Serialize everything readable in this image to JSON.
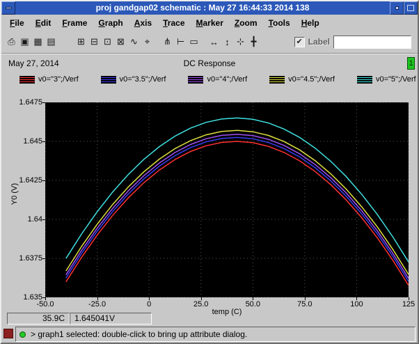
{
  "window": {
    "title": "proj gandgap02 schematic : May 27 16:44:33 2014 138"
  },
  "menu": {
    "items": [
      "File",
      "Edit",
      "Frame",
      "Graph",
      "Axis",
      "Trace",
      "Marker",
      "Zoom",
      "Tools",
      "Help"
    ]
  },
  "toolbar": {
    "icons": [
      {
        "name": "print",
        "glyph": "⎙"
      },
      {
        "name": "snapshot",
        "glyph": "▣"
      },
      {
        "name": "grid-display",
        "glyph": "▦"
      },
      {
        "name": "strip-mode",
        "glyph": "▤"
      },
      {
        "name": "subwindow",
        "glyph": "⊞"
      },
      {
        "name": "overlay",
        "glyph": "⊟"
      },
      {
        "name": "composite",
        "glyph": "⊡"
      },
      {
        "name": "delete-trace",
        "glyph": "⊠"
      },
      {
        "name": "slope-marker",
        "glyph": "∿"
      },
      {
        "name": "point-marker",
        "glyph": "⌖"
      },
      {
        "name": "vert-marker",
        "glyph": "⋔"
      },
      {
        "name": "horiz-marker",
        "glyph": "⊢"
      },
      {
        "name": "zoom-fit",
        "glyph": "▭"
      },
      {
        "name": "zoom-x",
        "glyph": "↔"
      },
      {
        "name": "zoom-y",
        "glyph": "↕"
      },
      {
        "name": "zoom-in",
        "glyph": "⊹"
      },
      {
        "name": "pan",
        "glyph": "╋"
      }
    ],
    "label_checkbox": {
      "label": "Label",
      "checked": true,
      "check_glyph": "✔"
    },
    "label_input": {
      "value": "",
      "placeholder": ""
    }
  },
  "header": {
    "date": "May 27, 2014",
    "title": "DC Response",
    "badge": "1"
  },
  "legend": [
    {
      "label": "v0=\"3\";/Verf",
      "color": "#ff3232"
    },
    {
      "label": "v0=\"3.5\";/Verf",
      "color": "#3c3cf0"
    },
    {
      "label": "v0=\"4\";/Verf",
      "color": "#a050f0"
    },
    {
      "label": "v0=\"4.5\";/Verf",
      "color": "#e0e040"
    },
    {
      "label": "v0=\"5\";/Verf",
      "color": "#40e0e0"
    }
  ],
  "chart_data": {
    "type": "line",
    "title": "DC Response",
    "xlabel": "temp (C)",
    "ylabel": "Y0 (V)",
    "xlim": [
      -50,
      125
    ],
    "ylim": [
      1.635,
      1.6475
    ],
    "grid": "dotted",
    "background": "#000000",
    "x_ticks": [
      {
        "value": -50,
        "label": "-50.0"
      },
      {
        "value": -25,
        "label": "-25.0"
      },
      {
        "value": 0,
        "label": "0"
      },
      {
        "value": 25,
        "label": "25.0"
      },
      {
        "value": 50,
        "label": "50.0"
      },
      {
        "value": 75,
        "label": "75.0"
      },
      {
        "value": 100,
        "label": "100"
      },
      {
        "value": 125,
        "label": "125"
      }
    ],
    "y_ticks": [
      {
        "value": 1.6475,
        "label": "1.6475"
      },
      {
        "value": 1.645,
        "label": "1.645"
      },
      {
        "value": 1.6425,
        "label": "1.6425"
      },
      {
        "value": 1.64,
        "label": "1.64"
      },
      {
        "value": 1.6375,
        "label": "1.6375"
      },
      {
        "value": 1.635,
        "label": "1.635"
      }
    ],
    "x": [
      -40,
      -32.5,
      -25,
      -17.5,
      -10,
      -2.5,
      5,
      12.5,
      20,
      27.5,
      35,
      42.5,
      50,
      57.5,
      65,
      72.5,
      80,
      87.5,
      95,
      102.5,
      110,
      117.5,
      125
    ],
    "series": [
      {
        "name": "v0=\"3\";/Verf",
        "color": "#ff3232",
        "values": [
          1.63599,
          1.637563,
          1.638985,
          1.640256,
          1.641377,
          1.642347,
          1.643166,
          1.643834,
          1.644351,
          1.644718,
          1.644934,
          1.645,
          1.644914,
          1.644678,
          1.644291,
          1.643754,
          1.643065,
          1.642226,
          1.641236,
          1.640095,
          1.638804,
          1.637362,
          1.635769
        ]
      },
      {
        "name": "v0=\"3.5\";/Verf",
        "color": "#3c3cf0",
        "values": [
          1.63624,
          1.637813,
          1.639235,
          1.640506,
          1.641627,
          1.642597,
          1.643416,
          1.644084,
          1.644601,
          1.644968,
          1.645184,
          1.64525,
          1.645164,
          1.644928,
          1.644541,
          1.644004,
          1.643315,
          1.642476,
          1.641486,
          1.640345,
          1.639054,
          1.637612,
          1.636019
        ]
      },
      {
        "name": "v0=\"4\";/Verf",
        "color": "#a050f0",
        "values": [
          1.63644,
          1.638013,
          1.639435,
          1.640706,
          1.641827,
          1.642797,
          1.643616,
          1.644284,
          1.644801,
          1.645168,
          1.645384,
          1.64545,
          1.645364,
          1.645128,
          1.644741,
          1.644204,
          1.643515,
          1.642676,
          1.641686,
          1.640545,
          1.639254,
          1.637812,
          1.636219
        ]
      },
      {
        "name": "v0=\"4.5\";/Verf",
        "color": "#e0e040",
        "values": [
          1.63669,
          1.638263,
          1.639685,
          1.640956,
          1.642077,
          1.643047,
          1.643866,
          1.644534,
          1.645051,
          1.645418,
          1.645634,
          1.6457,
          1.645614,
          1.645378,
          1.644991,
          1.644454,
          1.643765,
          1.642926,
          1.641936,
          1.640795,
          1.639504,
          1.638062,
          1.636469
        ]
      },
      {
        "name": "v0=\"5\";/Verf",
        "color": "#40e0e0",
        "values": [
          1.63749,
          1.639063,
          1.640485,
          1.641756,
          1.642877,
          1.643847,
          1.644666,
          1.645334,
          1.645851,
          1.646218,
          1.646434,
          1.6465,
          1.646414,
          1.646178,
          1.645791,
          1.645254,
          1.644565,
          1.643726,
          1.642736,
          1.641595,
          1.640304,
          1.638862,
          1.637269
        ]
      }
    ]
  },
  "readouts": {
    "x": "35.9C",
    "y": "1.645041V"
  },
  "status": {
    "message": "> graph1 selected: double-click to bring up attribute dialog."
  },
  "colors": {
    "titlebar": "#2b58b9",
    "plot_background": "#000000",
    "grid": "#5a5a5a",
    "badge_green": "#1ec41e",
    "status_dot_green": "#23cc23",
    "status_square_red": "#8c1f1f"
  }
}
